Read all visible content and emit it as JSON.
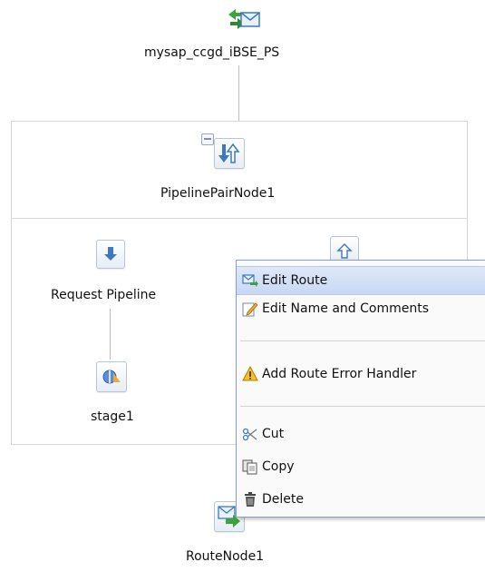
{
  "top_node": {
    "label": "mysap_ccgd_iBSE_PS"
  },
  "pipeline_pair": {
    "label": "PipelinePairNode1"
  },
  "request_pipeline": {
    "label": "Request Pipeline"
  },
  "stage": {
    "label": "stage1"
  },
  "route_node": {
    "label": "RouteNode1"
  },
  "context_menu": {
    "items": [
      {
        "label": "Edit Route",
        "icon": "edit-route-icon",
        "active": true
      },
      {
        "label": "Edit Name and Comments",
        "icon": "edit-pencil-icon"
      },
      {
        "label": "Add Route Error Handler",
        "icon": "warning-icon"
      },
      {
        "label": "Cut",
        "icon": "scissors-icon"
      },
      {
        "label": "Copy",
        "icon": "copy-icon"
      },
      {
        "label": "Delete",
        "icon": "trash-icon"
      }
    ]
  },
  "colors": {
    "menu_highlight": "#c8d8f4",
    "menu_border": "#8aa0c1",
    "icon_blue": "#3b78c8",
    "icon_green": "#3da33d"
  }
}
